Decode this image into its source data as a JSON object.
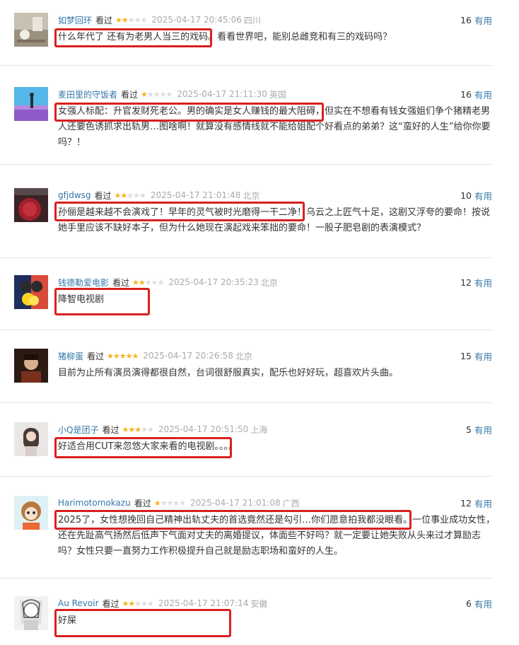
{
  "reviews": [
    {
      "user": "如梦回环",
      "status": "看过",
      "stars": "★★★★★",
      "rating": 2,
      "time": "2025-04-17 20:45:06",
      "location": "四川",
      "votes": "16",
      "vote_label": "有用",
      "content": "什么年代了 还有为老男人当三的戏码。看看世界吧，能别总雌竞和有三的戏码吗？"
    },
    {
      "user": "麦田里的守饭者",
      "status": "看过",
      "stars": "★★★★★",
      "rating": 1,
      "time": "2025-04-17 21:11:30",
      "location": "英国",
      "votes": "16",
      "vote_label": "有用",
      "content": "女强人标配：升官发财死老公。男的确实是女人赚钱的最大阻碍，但实在不想看有钱女强姐们争个猪精老男人还要色诱抓求出轨男…图啥啊！就算没有感情线就不能给姐配个好看点的弟弟？这“蛮好的人生”给你你要吗？！"
    },
    {
      "user": "gfjdwsg",
      "status": "看过",
      "stars": "★★★★★",
      "rating": 2,
      "time": "2025-04-17 21:01:48",
      "location": "北京",
      "votes": "10",
      "vote_label": "有用",
      "content": "孙俪是越来越不会演戏了！早年的灵气被时光磨得一干二净！乌云之上匠气十足，这剧又浮夸的要命！按说她手里应该不缺好本子，但为什么她现在演起戏来笨拙的要命！一股子肥皂剧的表演模式？"
    },
    {
      "user": "钱德勒爱电影",
      "status": "看过",
      "stars": "★★★★★",
      "rating": 2,
      "time": "2025-04-17 20:35:23",
      "location": "北京",
      "votes": "12",
      "vote_label": "有用",
      "content": "降智电视剧"
    },
    {
      "user": "猪柳蛋",
      "status": "看过",
      "stars": "★★★★★",
      "rating": 5,
      "time": "2025-04-17 20:26:58",
      "location": "北京",
      "votes": "15",
      "vote_label": "有用",
      "content": "目前为止所有演员演得都很自然，台词很舒服真实，配乐也好好玩，超喜欢片头曲。"
    },
    {
      "user": "小Q是团子",
      "status": "看过",
      "stars": "★★★★★",
      "rating": 3,
      "time": "2025-04-17 20:51:50",
      "location": "上海",
      "votes": "5",
      "vote_label": "有用",
      "content": "好适合用CUT来忽悠大家来看的电视剧。。。。"
    },
    {
      "user": "Harimotomokazu",
      "status": "看过",
      "stars": "★★★★★",
      "rating": 1,
      "time": "2025-04-17 21:01:08",
      "location": "广西",
      "votes": "12",
      "vote_label": "有用",
      "content": "2025了，女性想挽回自己精神出轨丈夫的首选竟然还是勾引…你们愿意拍我都没眼看。一位事业成功女性，还在先趾高气扬然后低声下气面对丈夫的离婚提议，体面些不好吗？就一定要让她失败从头来过才算励志吗？女性只要一直努力工作积极提升自己就是励志职场和蛮好的人生。"
    },
    {
      "user": "Au Revoir",
      "status": "看过",
      "stars": "★★★★★",
      "rating": 2,
      "time": "2025-04-17 21:07:14",
      "location": "安徽",
      "votes": "6",
      "vote_label": "有用",
      "content": "好屎"
    }
  ]
}
